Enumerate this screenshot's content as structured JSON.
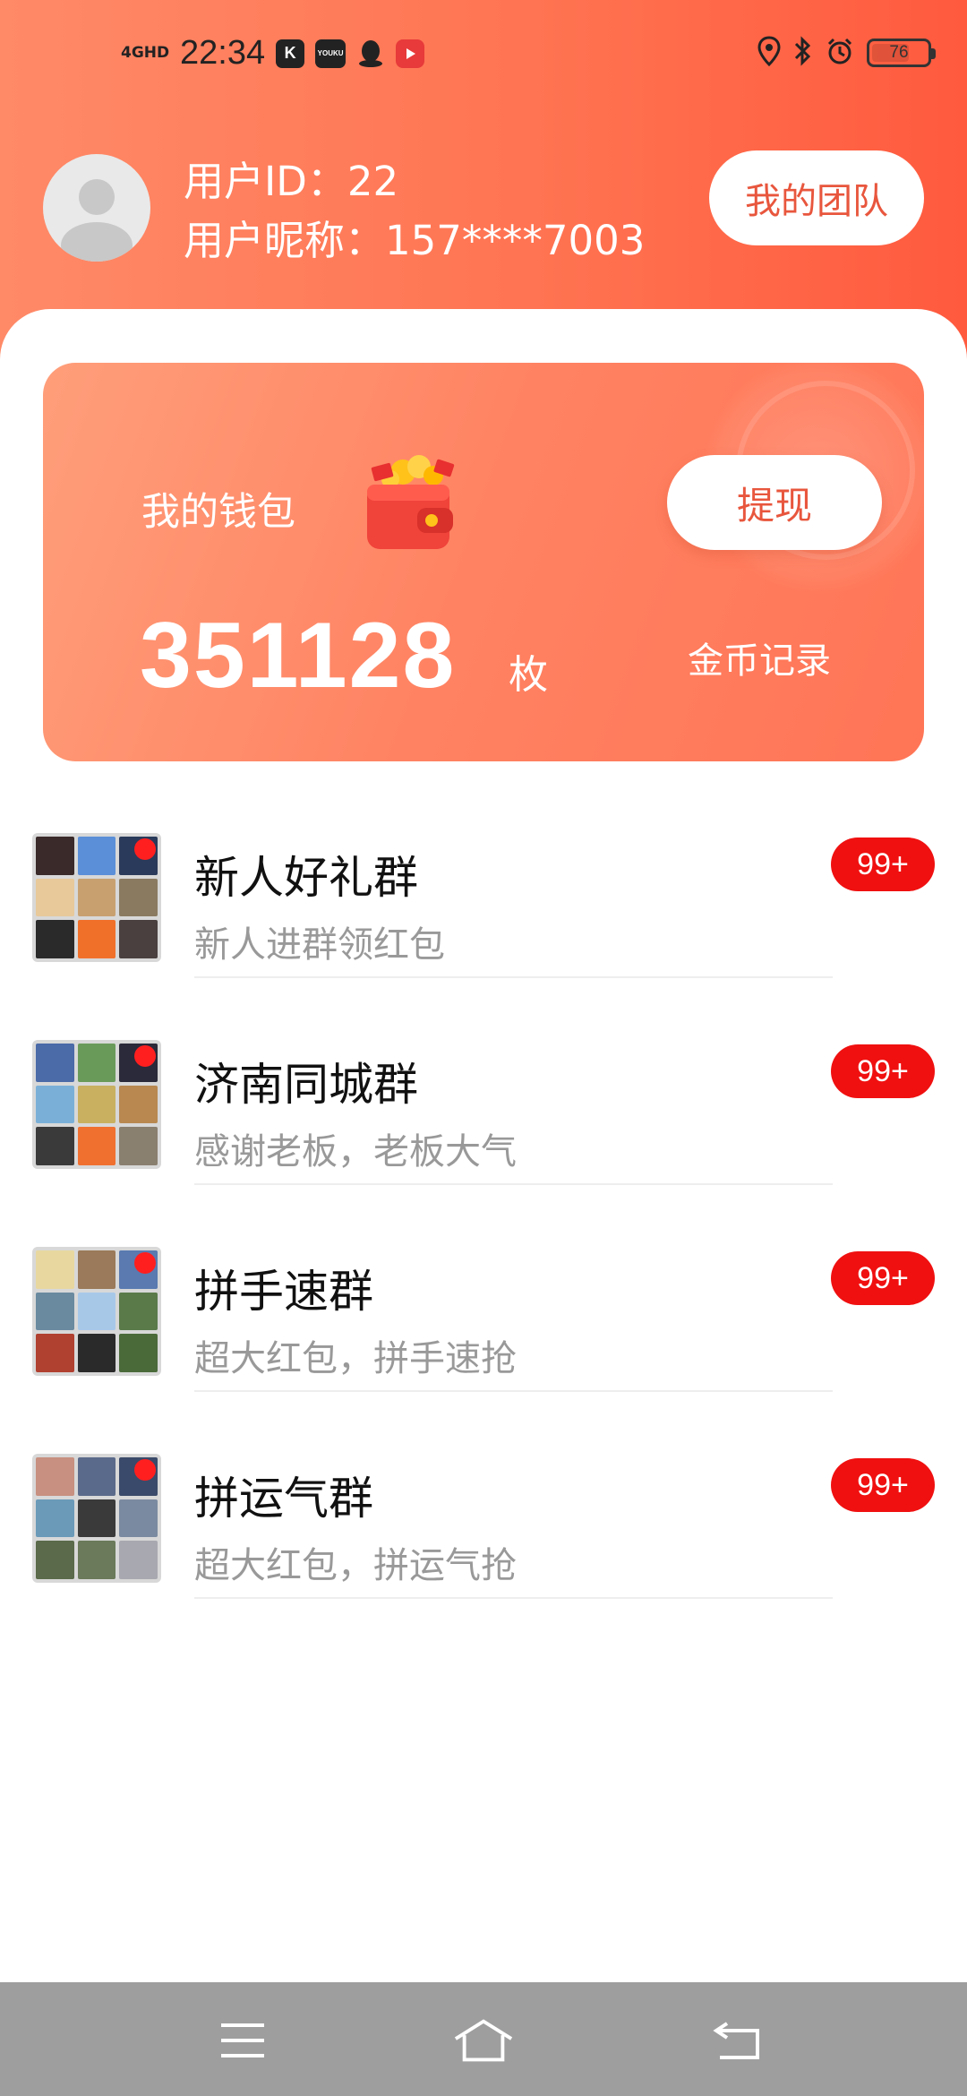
{
  "status_bar": {
    "network": "4GHD",
    "time": "22:34",
    "apps": [
      "K",
      "YOUKU"
    ],
    "battery": "76",
    "battery_level": 0.76
  },
  "profile": {
    "user_id_label": "用户ID：22",
    "nickname_label": "用户昵称：157****7003",
    "team_button": "我的团队"
  },
  "wallet": {
    "title": "我的钱包",
    "withdraw_button": "提现",
    "balance": "351128",
    "unit": "枚",
    "coin_record": "金币记录"
  },
  "groups": [
    {
      "name": "新人好礼群",
      "desc": "新人进群领红包",
      "badge": "99+"
    },
    {
      "name": "济南同城群",
      "desc": "感谢老板，老板大气",
      "badge": "99+"
    },
    {
      "name": "拼手速群",
      "desc": "超大红包，拼手速抢",
      "badge": "99+"
    },
    {
      "name": "拼运气群",
      "desc": "超大红包，拼运气抢",
      "badge": "99+"
    }
  ],
  "colors": {
    "accent": "#ff7452",
    "button_text": "#e8563d",
    "badge": "#f01010"
  },
  "nav": {
    "icons": [
      "menu-icon",
      "home-icon",
      "back-icon"
    ]
  }
}
